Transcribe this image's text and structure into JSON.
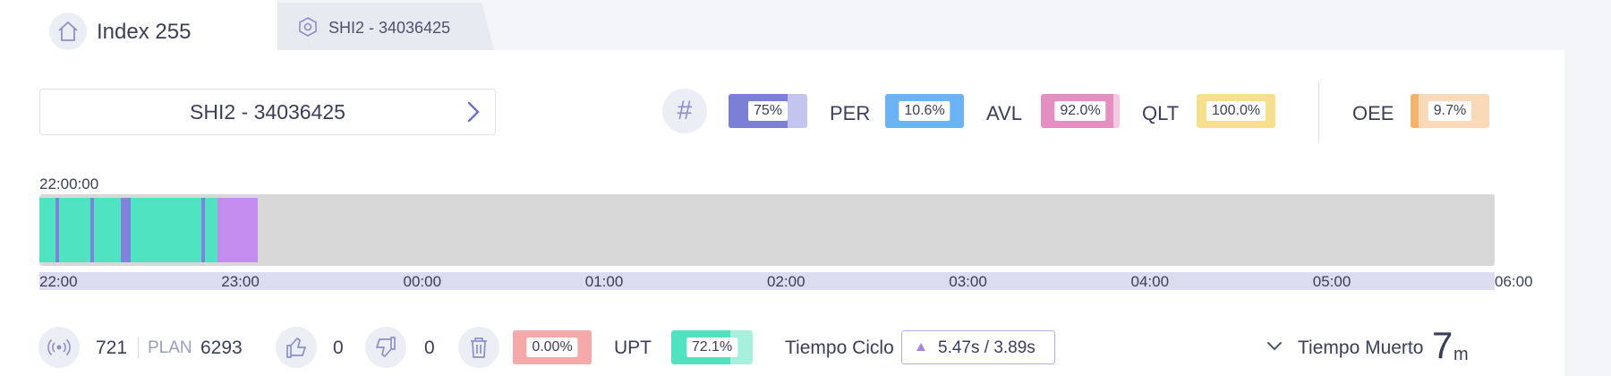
{
  "tabs": {
    "active_title": "Index 255",
    "inactive_title": "SHI2 - 34036425",
    "home_icon": "home-icon",
    "inactive_icon": "hexagon-icon"
  },
  "machine_selector": {
    "label": "SHI2 - 34036425",
    "icon": "chevron-right-icon"
  },
  "kpis": {
    "count": {
      "value": "75%",
      "fill": 0.75,
      "color": "#7b7fd6",
      "light": "#c3c5ee"
    },
    "per": {
      "label": "PER",
      "value": "10.6%",
      "fill": 1.0,
      "color": "#6cb3f5",
      "light": "#b9dbfa"
    },
    "avl": {
      "label": "AVL",
      "value": "92.0%",
      "fill": 0.92,
      "color": "#e48fc2",
      "light": "#f3c8e1"
    },
    "qlt": {
      "label": "QLT",
      "value": "100.0%",
      "fill": 1.0,
      "color": "#f7e08d",
      "light": "#fbefc4"
    },
    "oee": {
      "label": "OEE",
      "value": "9.7%",
      "fill": 0.097,
      "color": "#f5b46e",
      "light": "#fad9b8"
    }
  },
  "timeline": {
    "start_label": "22:00:00",
    "axis_ticks": [
      "22:00",
      "23:00",
      "00:00",
      "01:00",
      "02:00",
      "03:00",
      "04:00",
      "05:00",
      "06:00"
    ],
    "range_hours": [
      0,
      8
    ],
    "legend_colors": {
      "running": "#50e3c2",
      "micro_stop": "#7f83dc",
      "stop": "#c38cee"
    },
    "segments": [
      {
        "start_h": 0.0,
        "end_h": 0.09,
        "state": "running"
      },
      {
        "start_h": 0.09,
        "end_h": 0.11,
        "state": "micro_stop"
      },
      {
        "start_h": 0.11,
        "end_h": 0.28,
        "state": "running"
      },
      {
        "start_h": 0.28,
        "end_h": 0.3,
        "state": "micro_stop"
      },
      {
        "start_h": 0.3,
        "end_h": 0.45,
        "state": "running"
      },
      {
        "start_h": 0.45,
        "end_h": 0.5,
        "state": "micro_stop"
      },
      {
        "start_h": 0.5,
        "end_h": 0.89,
        "state": "running"
      },
      {
        "start_h": 0.89,
        "end_h": 0.91,
        "state": "micro_stop"
      },
      {
        "start_h": 0.91,
        "end_h": 0.98,
        "state": "running"
      },
      {
        "start_h": 0.98,
        "end_h": 1.2,
        "state": "stop"
      }
    ]
  },
  "bottom": {
    "sensor_icon": "sensor-icon",
    "count": "721",
    "plan_label": "PLAN",
    "plan_value": "6293",
    "good_icon": "thumbs-up-icon",
    "good_count": "0",
    "bad_icon": "thumbs-down-icon",
    "bad_count": "0",
    "scrap_icon": "trash-icon",
    "scrap_value": "0.00%",
    "scrap_fill": 1.0,
    "scrap_color": "#f6a9a9",
    "upt_label": "UPT",
    "upt_value": "72.1%",
    "upt_fill": 0.721,
    "upt_color": "#50e3c2",
    "upt_light": "#a8f0de",
    "ciclo_label": "Tiempo Ciclo",
    "ciclo_value": "5.47s  /  3.89s",
    "muerto_label": "Tiempo Muerto",
    "muerto_value": "7",
    "muerto_unit": "m"
  }
}
